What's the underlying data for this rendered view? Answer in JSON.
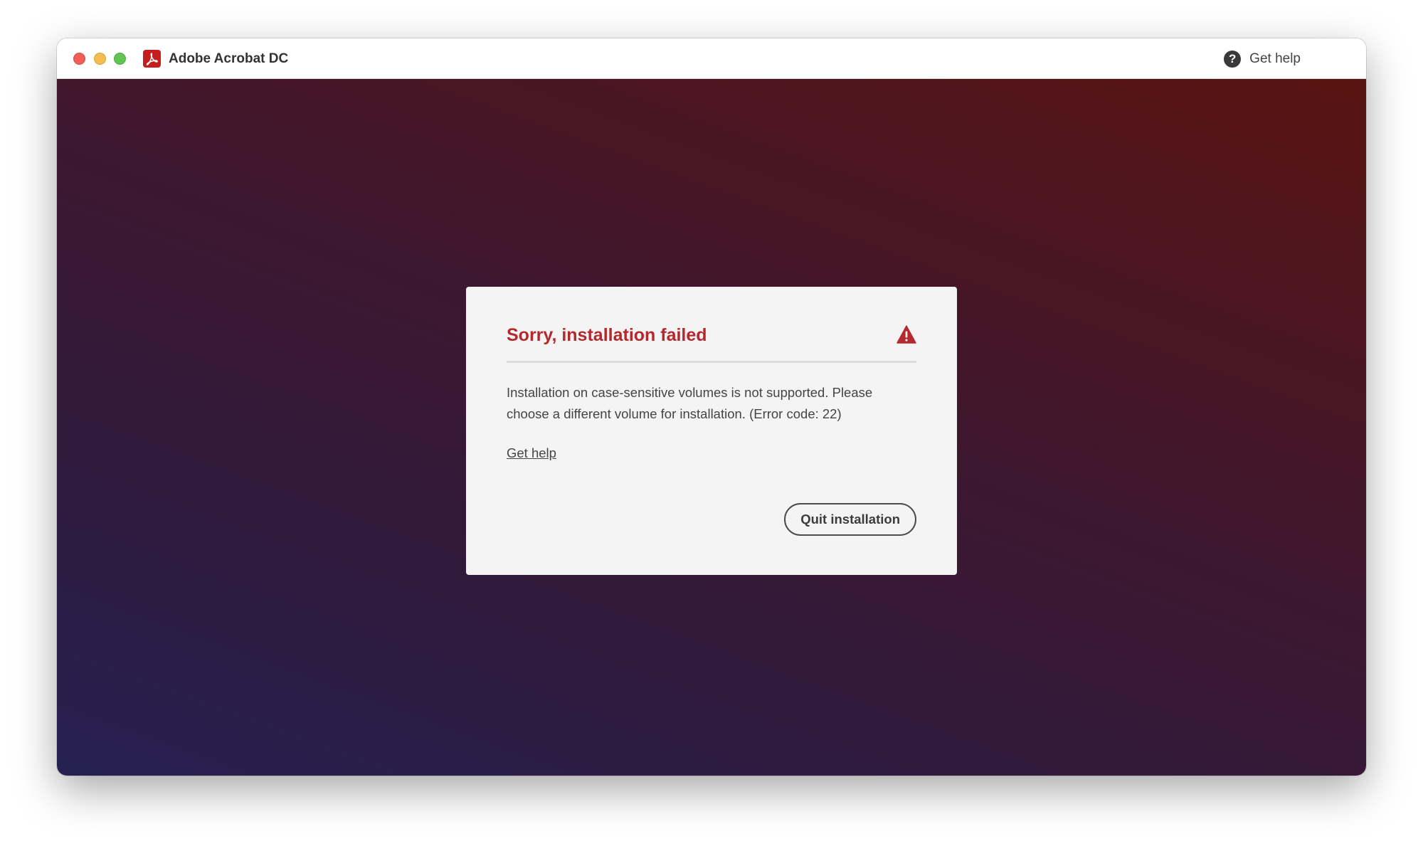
{
  "window": {
    "title": "Adobe Acrobat DC",
    "app_icon": "acrobat-logo-icon",
    "help_label": "Get help",
    "help_icon": "question-circle-icon"
  },
  "dialog": {
    "title": "Sorry, installation failed",
    "warning_icon": "warning-triangle-icon",
    "message": "Installation on case-sensitive volumes is not supported. Please choose a different volume for installation. (Error code: 22)",
    "link_label": "Get help",
    "quit_button_label": "Quit installation"
  },
  "colors": {
    "accent_red": "#b3292e",
    "acrobat_red": "#c41e1e",
    "traffic_close": "#ee5f57",
    "traffic_minimize": "#f5bd4f",
    "traffic_maximize": "#61c554"
  }
}
